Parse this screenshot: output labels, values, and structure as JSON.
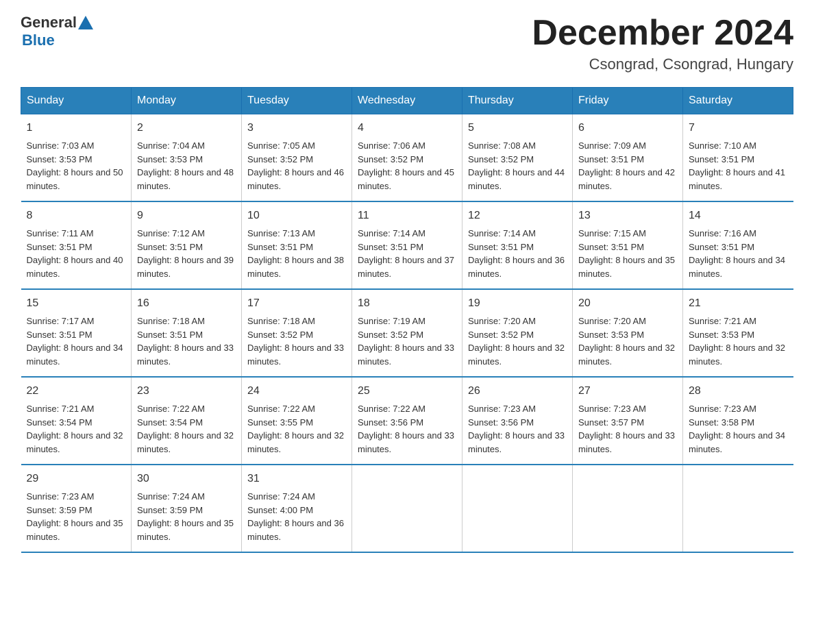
{
  "logo": {
    "general": "General",
    "blue": "Blue"
  },
  "title": "December 2024",
  "location": "Csongrad, Csongrad, Hungary",
  "days_of_week": [
    "Sunday",
    "Monday",
    "Tuesday",
    "Wednesday",
    "Thursday",
    "Friday",
    "Saturday"
  ],
  "weeks": [
    [
      {
        "day": "1",
        "sunrise": "7:03 AM",
        "sunset": "3:53 PM",
        "daylight": "8 hours and 50 minutes."
      },
      {
        "day": "2",
        "sunrise": "7:04 AM",
        "sunset": "3:53 PM",
        "daylight": "8 hours and 48 minutes."
      },
      {
        "day": "3",
        "sunrise": "7:05 AM",
        "sunset": "3:52 PM",
        "daylight": "8 hours and 46 minutes."
      },
      {
        "day": "4",
        "sunrise": "7:06 AM",
        "sunset": "3:52 PM",
        "daylight": "8 hours and 45 minutes."
      },
      {
        "day": "5",
        "sunrise": "7:08 AM",
        "sunset": "3:52 PM",
        "daylight": "8 hours and 44 minutes."
      },
      {
        "day": "6",
        "sunrise": "7:09 AM",
        "sunset": "3:51 PM",
        "daylight": "8 hours and 42 minutes."
      },
      {
        "day": "7",
        "sunrise": "7:10 AM",
        "sunset": "3:51 PM",
        "daylight": "8 hours and 41 minutes."
      }
    ],
    [
      {
        "day": "8",
        "sunrise": "7:11 AM",
        "sunset": "3:51 PM",
        "daylight": "8 hours and 40 minutes."
      },
      {
        "day": "9",
        "sunrise": "7:12 AM",
        "sunset": "3:51 PM",
        "daylight": "8 hours and 39 minutes."
      },
      {
        "day": "10",
        "sunrise": "7:13 AM",
        "sunset": "3:51 PM",
        "daylight": "8 hours and 38 minutes."
      },
      {
        "day": "11",
        "sunrise": "7:14 AM",
        "sunset": "3:51 PM",
        "daylight": "8 hours and 37 minutes."
      },
      {
        "day": "12",
        "sunrise": "7:14 AM",
        "sunset": "3:51 PM",
        "daylight": "8 hours and 36 minutes."
      },
      {
        "day": "13",
        "sunrise": "7:15 AM",
        "sunset": "3:51 PM",
        "daylight": "8 hours and 35 minutes."
      },
      {
        "day": "14",
        "sunrise": "7:16 AM",
        "sunset": "3:51 PM",
        "daylight": "8 hours and 34 minutes."
      }
    ],
    [
      {
        "day": "15",
        "sunrise": "7:17 AM",
        "sunset": "3:51 PM",
        "daylight": "8 hours and 34 minutes."
      },
      {
        "day": "16",
        "sunrise": "7:18 AM",
        "sunset": "3:51 PM",
        "daylight": "8 hours and 33 minutes."
      },
      {
        "day": "17",
        "sunrise": "7:18 AM",
        "sunset": "3:52 PM",
        "daylight": "8 hours and 33 minutes."
      },
      {
        "day": "18",
        "sunrise": "7:19 AM",
        "sunset": "3:52 PM",
        "daylight": "8 hours and 33 minutes."
      },
      {
        "day": "19",
        "sunrise": "7:20 AM",
        "sunset": "3:52 PM",
        "daylight": "8 hours and 32 minutes."
      },
      {
        "day": "20",
        "sunrise": "7:20 AM",
        "sunset": "3:53 PM",
        "daylight": "8 hours and 32 minutes."
      },
      {
        "day": "21",
        "sunrise": "7:21 AM",
        "sunset": "3:53 PM",
        "daylight": "8 hours and 32 minutes."
      }
    ],
    [
      {
        "day": "22",
        "sunrise": "7:21 AM",
        "sunset": "3:54 PM",
        "daylight": "8 hours and 32 minutes."
      },
      {
        "day": "23",
        "sunrise": "7:22 AM",
        "sunset": "3:54 PM",
        "daylight": "8 hours and 32 minutes."
      },
      {
        "day": "24",
        "sunrise": "7:22 AM",
        "sunset": "3:55 PM",
        "daylight": "8 hours and 32 minutes."
      },
      {
        "day": "25",
        "sunrise": "7:22 AM",
        "sunset": "3:56 PM",
        "daylight": "8 hours and 33 minutes."
      },
      {
        "day": "26",
        "sunrise": "7:23 AM",
        "sunset": "3:56 PM",
        "daylight": "8 hours and 33 minutes."
      },
      {
        "day": "27",
        "sunrise": "7:23 AM",
        "sunset": "3:57 PM",
        "daylight": "8 hours and 33 minutes."
      },
      {
        "day": "28",
        "sunrise": "7:23 AM",
        "sunset": "3:58 PM",
        "daylight": "8 hours and 34 minutes."
      }
    ],
    [
      {
        "day": "29",
        "sunrise": "7:23 AM",
        "sunset": "3:59 PM",
        "daylight": "8 hours and 35 minutes."
      },
      {
        "day": "30",
        "sunrise": "7:24 AM",
        "sunset": "3:59 PM",
        "daylight": "8 hours and 35 minutes."
      },
      {
        "day": "31",
        "sunrise": "7:24 AM",
        "sunset": "4:00 PM",
        "daylight": "8 hours and 36 minutes."
      },
      null,
      null,
      null,
      null
    ]
  ]
}
